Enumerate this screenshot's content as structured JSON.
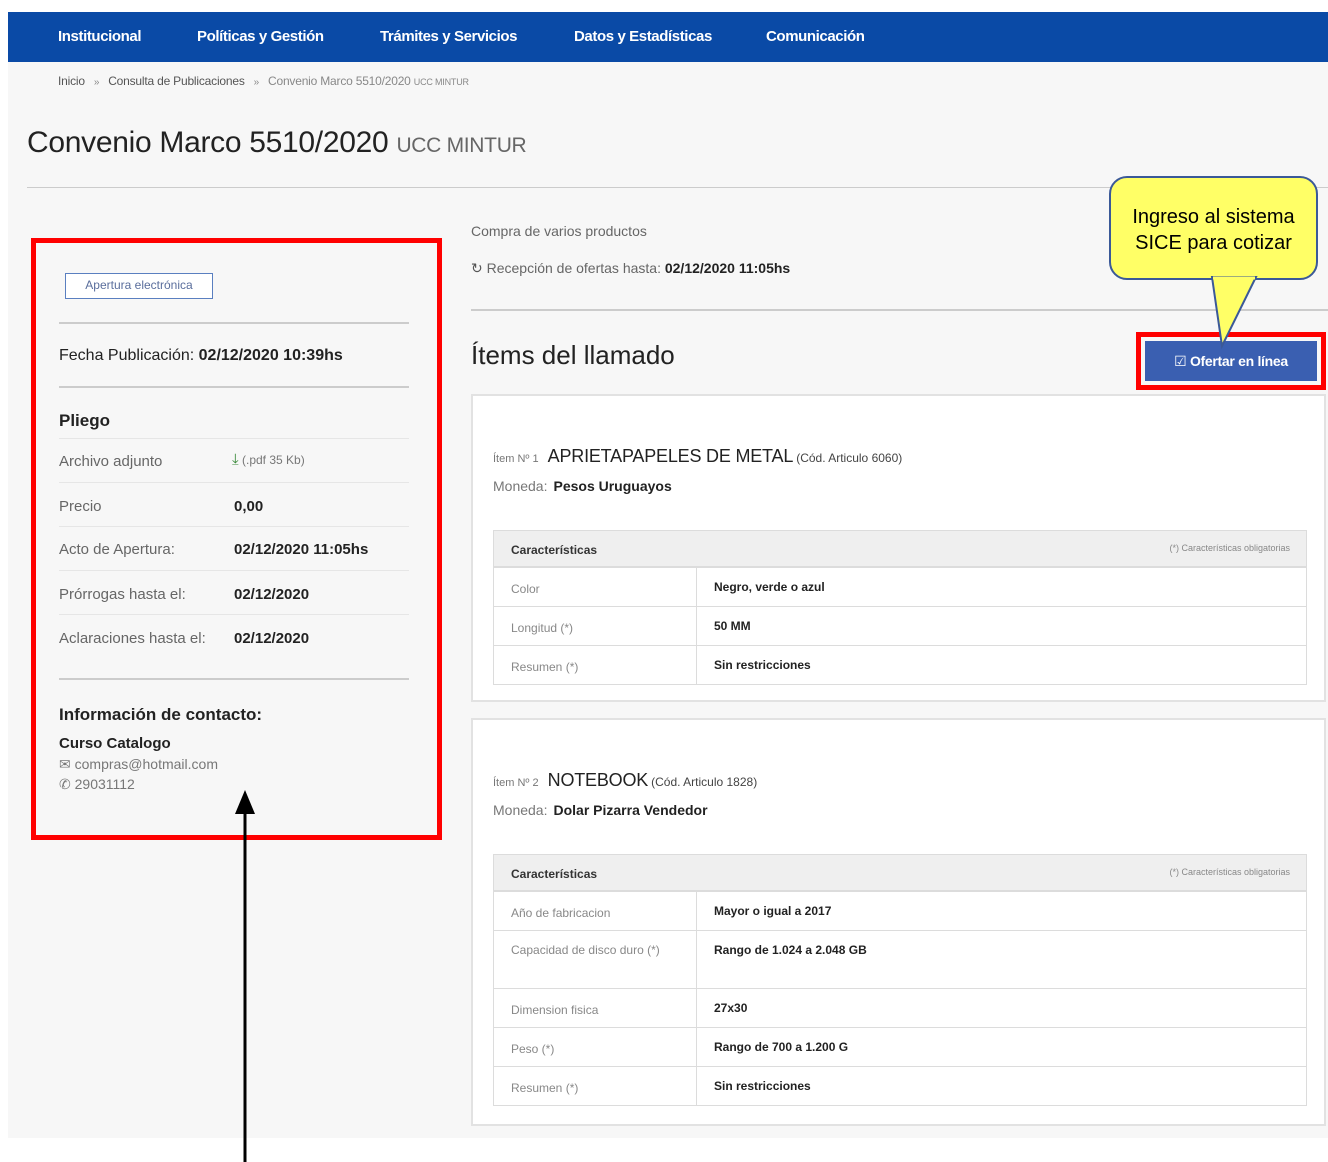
{
  "nav": {
    "items": [
      "Institucional",
      "Políticas y Gestión",
      "Trámites y Servicios",
      "Datos y Estadísticas",
      "Comunicación"
    ]
  },
  "breadcrumb": {
    "home": "Inicio",
    "section": "Consulta de Publicaciones",
    "current": "Convenio Marco 5510/2020",
    "current_sub": "UCC MINTUR"
  },
  "title": {
    "main": "Convenio Marco 5510/2020",
    "sub": "UCC MINTUR"
  },
  "left": {
    "badge": "Apertura electrónica",
    "fecha_label": "Fecha Publicación:",
    "fecha_value": "02/12/2020 10:39hs",
    "pliego_title": "Pliego",
    "archivo_label": "Archivo adjunto",
    "archivo_value": "(.pdf 35 Kb)",
    "precio_label": "Precio",
    "precio_value": "0,00",
    "apertura_label": "Acto de Apertura:",
    "apertura_value": "02/12/2020 11:05hs",
    "prorrogas_label": "Prórrogas hasta el:",
    "prorrogas_value": "02/12/2020",
    "aclaraciones_label": "Aclaraciones hasta el:",
    "aclaraciones_value": "02/12/2020",
    "contact_title": "Información de contacto:",
    "contact_name": "Curso Catalogo",
    "contact_email": "compras@hotmail.com",
    "contact_phone": "29031112",
    "email_icon": "envelope-icon",
    "phone_icon": "phone-icon"
  },
  "right": {
    "compra": "Compra de varios productos",
    "recepcion_label": "Recepción de ofertas hasta:",
    "recepcion_value": "02/12/2020 11:05hs",
    "items_title": "Ítems del llamado",
    "ofertar_label": "Ofertar en línea"
  },
  "callout": {
    "line1": "Ingreso al sistema",
    "line2": "SICE para cotizar"
  },
  "items": [
    {
      "prefix": "Ítem Nº 1",
      "name": "APRIETAPAPELES DE METAL",
      "cod": "(Cód. Articulo 6060)",
      "moneda_label": "Moneda:",
      "moneda_value": "Pesos Uruguayos",
      "char_header": "Características",
      "char_note": "(*) Características obligatorias",
      "rows": [
        {
          "k": "Color",
          "v": "Negro, verde o azul"
        },
        {
          "k": "Longitud (*)",
          "v": "50 MM"
        },
        {
          "k": "Resumen (*)",
          "v": "Sin restricciones"
        }
      ]
    },
    {
      "prefix": "Ítem Nº 2",
      "name": "NOTEBOOK",
      "cod": "(Cód. Articulo 1828)",
      "moneda_label": "Moneda:",
      "moneda_value": "Dolar Pizarra Vendedor",
      "char_header": "Características",
      "char_note": "(*) Características obligatorias",
      "rows": [
        {
          "k": "Año de fabricacion",
          "v": "Mayor o igual a 2017"
        },
        {
          "k": "Capacidad de disco duro (*)",
          "v": "Rango de 1.024 a 2.048 GB"
        },
        {
          "k": "Dimension fisica",
          "v": "27x30"
        },
        {
          "k": "Peso (*)",
          "v": "Rango de 700 a 1.200 G"
        },
        {
          "k": "Resumen (*)",
          "v": "Sin restricciones"
        }
      ]
    }
  ]
}
